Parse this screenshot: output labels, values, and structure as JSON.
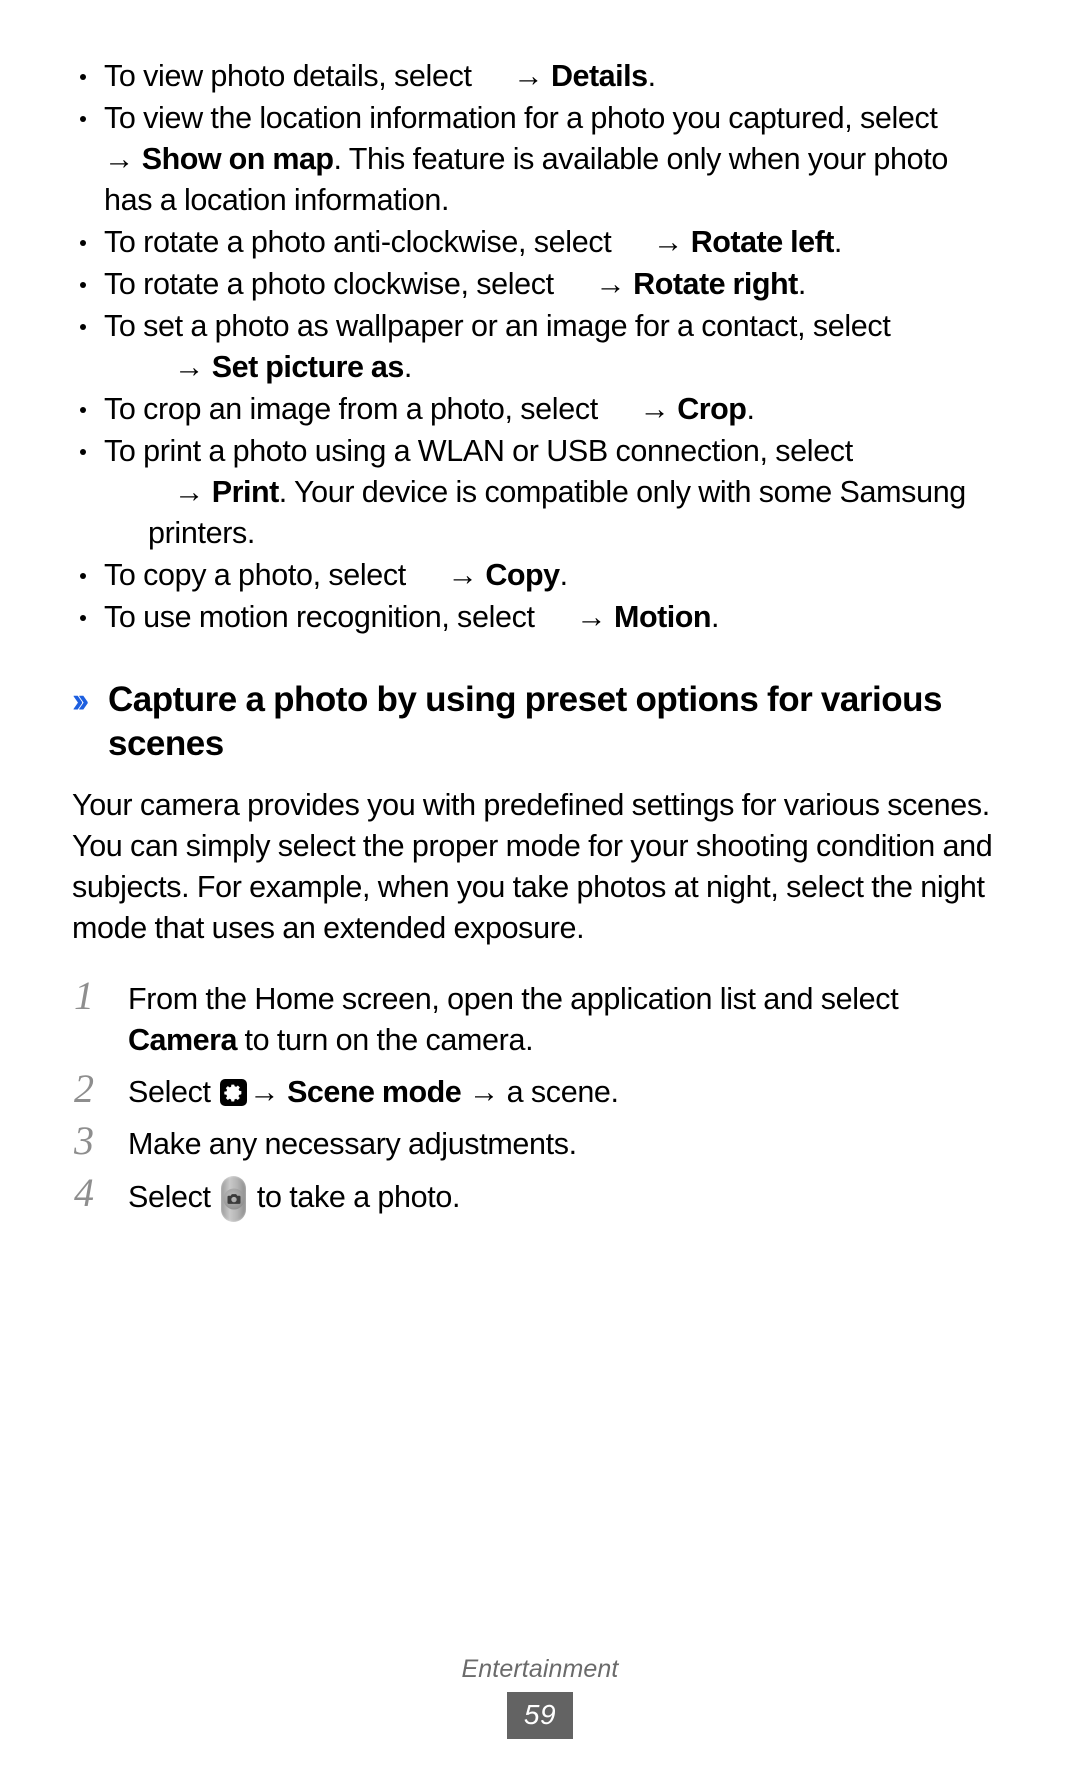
{
  "document": {
    "type": "user-manual-page",
    "page_number": "59",
    "footer_label": "Entertainment"
  },
  "bullets": [
    {
      "id": "details",
      "pre": "To view photo details, select",
      "has_icon_slot": true,
      "arrow": "→",
      "bold": "Details",
      "post": "."
    },
    {
      "id": "show-on-map",
      "pre": "To view the location information for a photo you captured, select",
      "has_icon_slot": true,
      "arrow": "→",
      "bold": "Show on map",
      "post": ". This feature is available only when your photo has a location information."
    },
    {
      "id": "rotate-left",
      "pre": "To rotate a photo anti-clockwise, select",
      "has_icon_slot": true,
      "arrow": "→",
      "bold": "Rotate left",
      "post": "."
    },
    {
      "id": "rotate-right",
      "pre": "To rotate a photo clockwise, select",
      "has_icon_slot": true,
      "arrow": "→",
      "bold": "Rotate right",
      "post": "."
    },
    {
      "id": "set-picture-as",
      "pre": "To set a photo as wallpaper or an image for a contact, select",
      "has_icon_slot": true,
      "arrow": "→",
      "bold": "Set picture as",
      "post": "."
    },
    {
      "id": "crop",
      "pre": "To crop an image from a photo, select",
      "has_icon_slot": true,
      "arrow": "→",
      "bold": "Crop",
      "post": "."
    },
    {
      "id": "print",
      "pre": "To print a photo using a WLAN or USB connection, select",
      "has_icon_slot": true,
      "arrow": "→",
      "bold": "Print",
      "post": ". Your device is compatible only with some Samsung printers."
    },
    {
      "id": "copy",
      "pre": "To copy a photo, select",
      "has_icon_slot": true,
      "arrow": "→",
      "bold": "Copy",
      "post": "."
    },
    {
      "id": "motion",
      "pre": "To use motion recognition, select",
      "has_icon_slot": true,
      "arrow": "→",
      "bold": "Motion",
      "post": "."
    }
  ],
  "section": {
    "chevron": "››",
    "chevron_color": "#1d5fe0",
    "heading": "Capture a photo by using preset options for various scenes",
    "intro": "Your camera provides you with predefined settings for various scenes. You can simply select the proper mode for your shooting condition and subjects. For example, when you take photos at night, select the night mode that uses an extended exposure."
  },
  "steps": [
    {
      "num": "1",
      "pre": "From the Home screen, open the application list and select ",
      "bold": "Camera",
      "post": " to turn on the camera."
    },
    {
      "num": "2",
      "pre": "Select ",
      "icon": "gear-icon",
      "arrow1": "→",
      "bold": "Scene mode",
      "arrow2": "→",
      "post": "a scene."
    },
    {
      "num": "3",
      "pre": "Make any necessary adjustments.",
      "bold": "",
      "post": ""
    },
    {
      "num": "4",
      "pre": "Select ",
      "icon": "shutter-icon",
      "post": " to take a photo."
    }
  ]
}
